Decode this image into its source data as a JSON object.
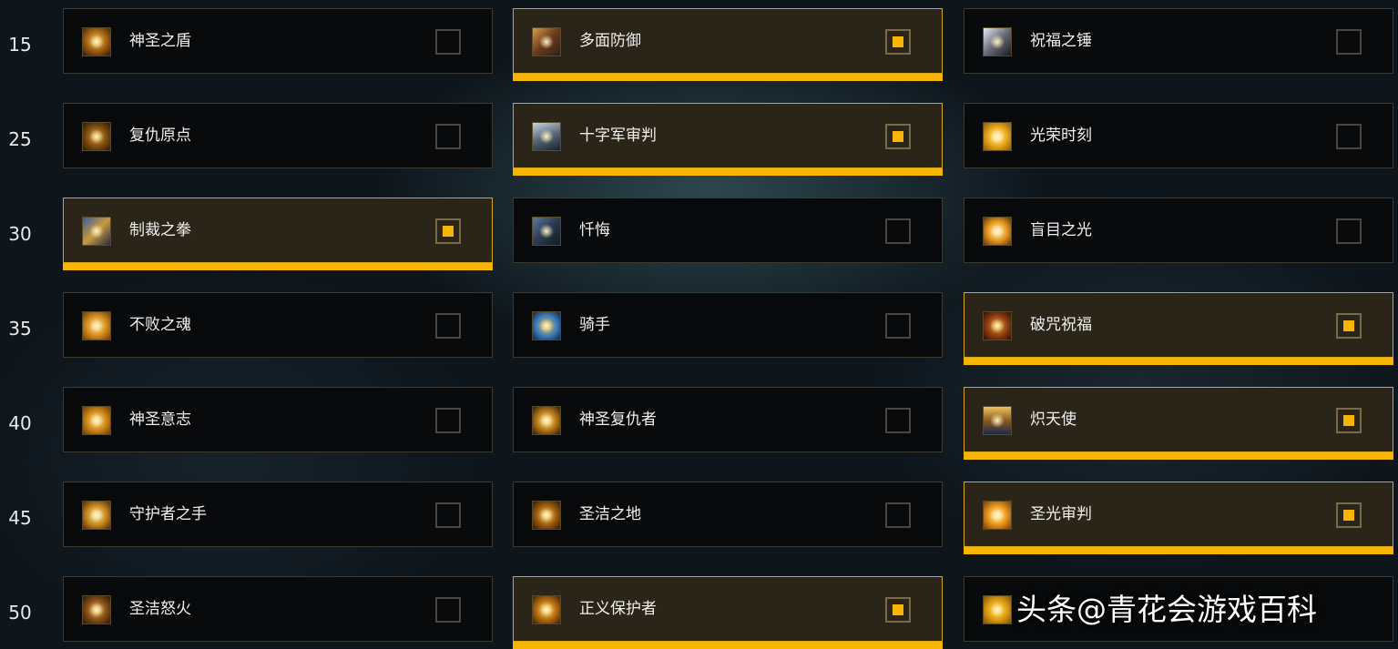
{
  "rows": [
    {
      "level": "15",
      "talents": [
        {
          "name": "神圣之盾",
          "icon": "golden-shield-icon",
          "selected": false
        },
        {
          "name": "多面防御",
          "icon": "dragon-shield-icon",
          "selected": true
        },
        {
          "name": "祝福之锤",
          "icon": "silver-hammer-icon",
          "selected": false
        }
      ]
    },
    {
      "level": "25",
      "talents": [
        {
          "name": "复仇原点",
          "icon": "golden-ring-icon",
          "selected": false
        },
        {
          "name": "十字军审判",
          "icon": "steel-hammer-icon",
          "selected": true
        },
        {
          "name": "光荣时刻",
          "icon": "light-burst-icon",
          "selected": false
        }
      ]
    },
    {
      "level": "30",
      "talents": [
        {
          "name": "制裁之拳",
          "icon": "fist-icon",
          "selected": true
        },
        {
          "name": "忏悔",
          "icon": "armored-knight-icon",
          "selected": false
        },
        {
          "name": "盲目之光",
          "icon": "holy-cross-icon",
          "selected": false
        }
      ]
    },
    {
      "level": "35",
      "talents": [
        {
          "name": "不败之魂",
          "icon": "holy-spirit-icon",
          "selected": false
        },
        {
          "name": "骑手",
          "icon": "cavalier-icon",
          "selected": false
        },
        {
          "name": "破咒祝福",
          "icon": "golden-shield-icon",
          "selected": true
        }
      ]
    },
    {
      "level": "40",
      "talents": [
        {
          "name": "神圣意志",
          "icon": "holy-will-icon",
          "selected": false
        },
        {
          "name": "神圣复仇者",
          "icon": "winged-avenger-icon",
          "selected": false
        },
        {
          "name": "炽天使",
          "icon": "seraphim-icon",
          "selected": true
        }
      ]
    },
    {
      "level": "45",
      "talents": [
        {
          "name": "守护者之手",
          "icon": "guardian-hand-icon",
          "selected": false
        },
        {
          "name": "圣洁之地",
          "icon": "consecrated-ground-icon",
          "selected": false
        },
        {
          "name": "圣光审判",
          "icon": "light-judgment-icon",
          "selected": true
        }
      ]
    },
    {
      "level": "50",
      "talents": [
        {
          "name": "圣洁怒火",
          "icon": "consecrated-wrath-icon",
          "selected": false
        },
        {
          "name": "正义保护者",
          "icon": "righteous-protector-icon",
          "selected": true
        },
        {
          "name": "",
          "icon": "golden-aura-icon",
          "selected": false
        }
      ]
    }
  ],
  "watermark": "头条@青花会游戏百科",
  "colors": {
    "accent": "#f7b400",
    "selected_bg": "#2b2418",
    "tile_bg": "#07090b"
  }
}
